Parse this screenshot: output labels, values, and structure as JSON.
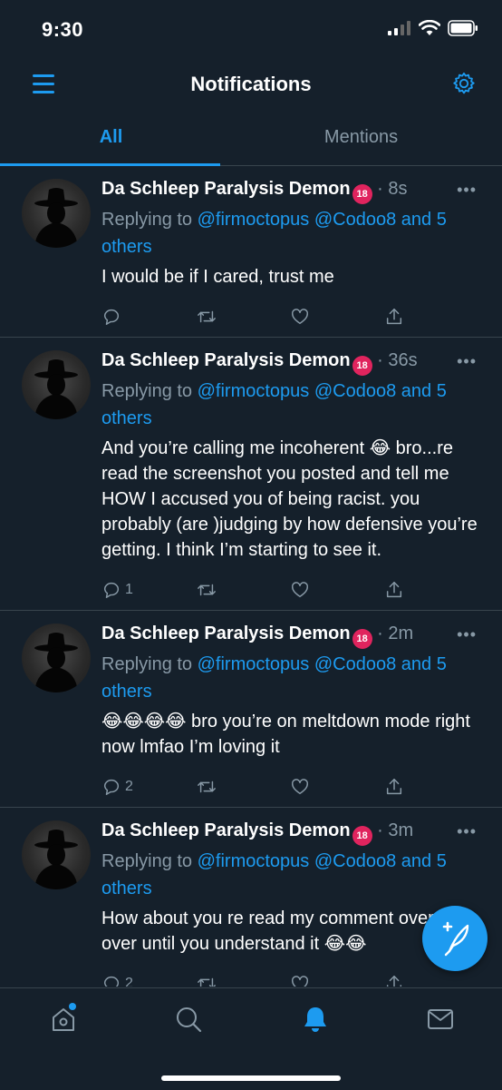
{
  "status_bar": {
    "time": "9:30"
  },
  "header": {
    "title": "Notifications"
  },
  "tabs": [
    {
      "label": "All",
      "active": true
    },
    {
      "label": "Mentions",
      "active": false
    }
  ],
  "tweets": [
    {
      "name": "Da Schleep Paralysis Demon",
      "badge": "18",
      "time": "· 8s",
      "replying_prefix": "Replying to",
      "replying_to": "@firmoctopus @Codoo8 and 5 others",
      "text": "I would be if I cared, trust me",
      "reply_count": ""
    },
    {
      "name": "Da Schleep Paralysis Demon",
      "badge": "18",
      "time": "· 36s",
      "replying_prefix": "Replying to",
      "replying_to": "@firmoctopus @Codoo8 and 5 others",
      "text": "And you’re calling me incoherent 😂 bro...re read the screenshot you posted and tell me HOW I accused you of being racist. you probably (are )judging by how defensive you’re getting. I think I’m starting to see it.",
      "reply_count": "1"
    },
    {
      "name": "Da Schleep Paralysis Demon",
      "badge": "18",
      "time": "· 2m",
      "replying_prefix": "Replying to",
      "replying_to": "@firmoctopus @Codoo8 and 5 others",
      "text": "😂😂😂😂 bro you’re on meltdown mode right now lmfao I’m loving it",
      "reply_count": "2"
    },
    {
      "name": "Da Schleep Paralysis Demon",
      "badge": "18",
      "time": "· 3m",
      "replying_prefix": "Replying to",
      "replying_to": "@firmoctopus @Codoo8 and 5 others",
      "text": "How about you re read my comment over and over until you understand it 😂😂",
      "reply_count": "2"
    }
  ],
  "colors": {
    "background": "#15202b",
    "accent": "#1d9bf0",
    "muted": "#8899a6",
    "divider": "#38444d"
  },
  "icons": [
    "hamburger-icon",
    "gear-icon",
    "reply-icon",
    "retweet-icon",
    "like-icon",
    "share-icon",
    "compose-icon",
    "home-icon",
    "search-icon",
    "bell-icon",
    "mail-icon"
  ]
}
